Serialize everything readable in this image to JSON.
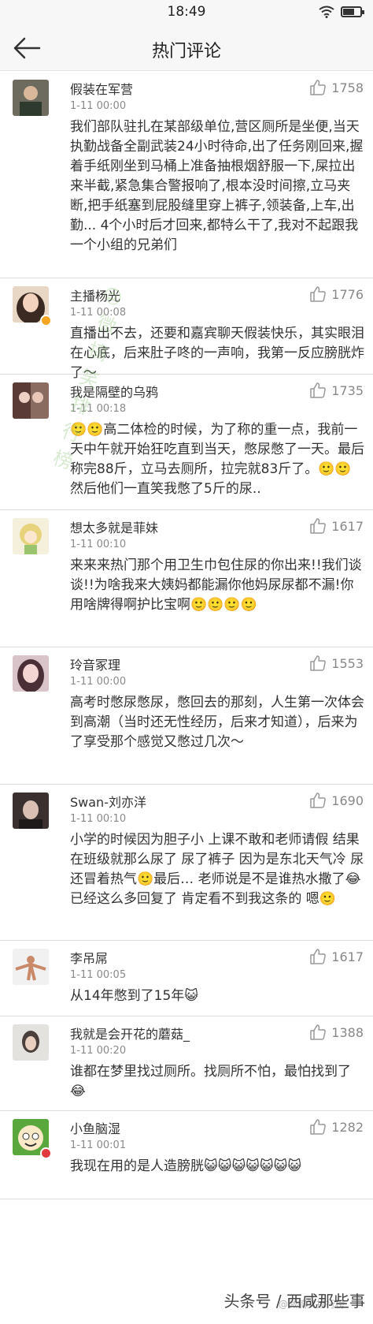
{
  "status_bar": {
    "time": "18:49"
  },
  "header": {
    "title": "热门评论"
  },
  "comments": [
    {
      "user": "假装在军营",
      "time": "1-11 00:00",
      "likes": "1758",
      "text": "我们部队驻扎在某部级单位,营区厕所是坐便,当天执勤战备全副武装24小时待命,出了任务刚回来,握着手纸刚坐到马桶上准备抽根烟舒服一下,屎拉出来半截,紧急集合警报响了,根本没时间擦,立马夹断,把手纸塞到屁股缝里穿上裤子,领装备,上车,出勤... 4个小时后才回来,都特么干了,我对不起跟我一个小组的兄弟们"
    },
    {
      "user": "主播杨光",
      "time": "1-11 00:08",
      "likes": "1776",
      "text": "直播出不去，还要和嘉宾聊天假装快乐，其实眼泪在心底，后来肚子咚的一声响，我第一反应膀胱炸了～"
    },
    {
      "user": "我是隔壁的乌鸦",
      "time": "1-11 00:18",
      "likes": "1735",
      "text": "🙂🙂高二体检的时候，为了称的重一点，我前一天中午就开始狂吃直到当天，憋尿憋了一天。最后称完88斤，立马去厕所，拉完就83斤了。🙂🙂然后他们一直笑我憋了5斤的尿.."
    },
    {
      "user": "想太多就是菲妹",
      "time": "1-11 00:10",
      "likes": "1617",
      "text": "来来来热门那个用卫生巾包住尿的你出来!!我们谈谈!!为啥我来大姨妈都能漏你他妈尿尿都不漏!你用啥牌得啊护比宝啊🙂🙂🙂🙂"
    },
    {
      "user": "玲音冢理",
      "time": "1-11 00:00",
      "likes": "1553",
      "text": "高考时憋尿憋尿，憋回去的那刻，人生第一次体会到高潮（当时还无性经历，后来才知道），后来为了享受那个感觉又憋过几次～"
    },
    {
      "user": "Swan-刘亦洋",
      "time": "1-11 00:10",
      "likes": "1690",
      "text": "小学的时候因为胆子小 上课不敢和老师请假 结果在班级就那么尿了 尿了裤子 因为是东北天气冷 尿还冒着热气🙂最后… 老师说是不是谁热水撒了😂 已经这么多回复了 肯定看不到我这条的 嗯🙂"
    },
    {
      "user": "李吊屌",
      "time": "1-11 00:05",
      "likes": "1617",
      "text": "从14年憋到了15年😺"
    },
    {
      "user": "我就是会开花的蘑菇_",
      "time": "1-11 00:20",
      "likes": "1388",
      "text": "谁都在梦里找过厕所。找厕所不怕，最怕找到了😂"
    },
    {
      "user": "小鱼脑湿",
      "time": "1-11 00:01",
      "likes": "1282",
      "text": "我现在用的是人造膀胱😺😺😺😺😺😺😺"
    }
  ],
  "watermark": "@微搞笑排行榜",
  "footer": {
    "label": "头条号 / 西咸那些事",
    "watermark": "@微搞笑排行榜"
  },
  "colors": {
    "badge_verified": "#f5a623",
    "badge_red": "#e0393e",
    "text": "#333333",
    "meta": "#8a8a8a"
  }
}
